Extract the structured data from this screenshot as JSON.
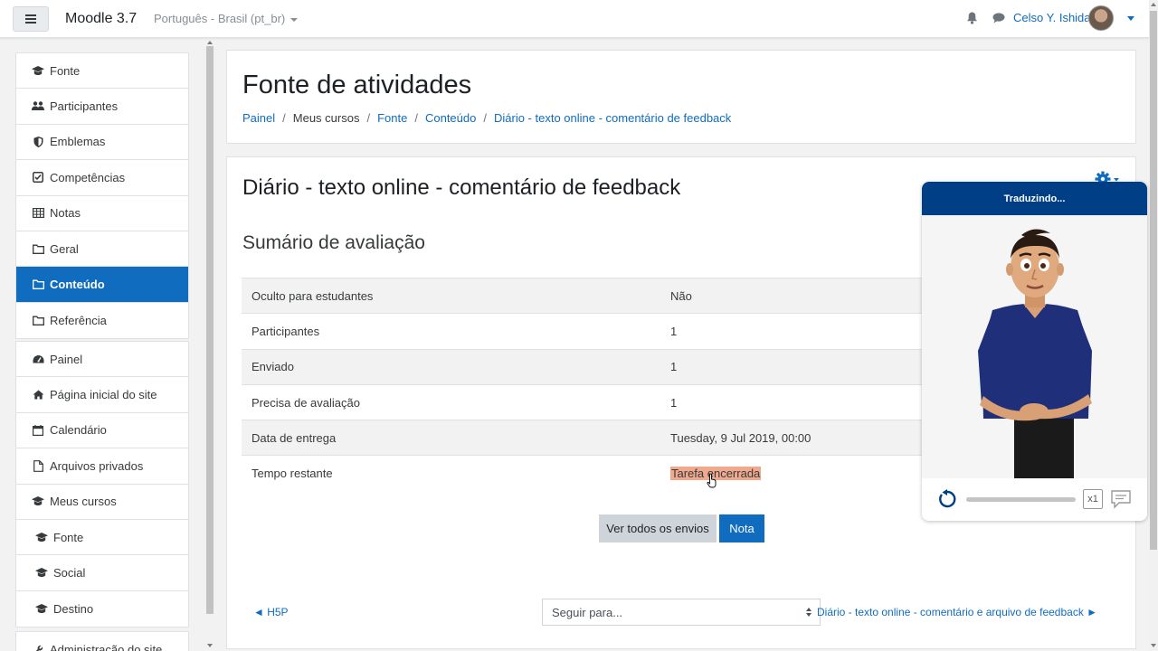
{
  "navbar": {
    "brand": "Moodle 3.7",
    "language": "Português - Brasil (pt_br)",
    "user_name": "Celso Y. Ishida"
  },
  "sidebar": {
    "course_items": [
      {
        "label": "Fonte",
        "icon": "graduation-cap-icon"
      },
      {
        "label": "Participantes",
        "icon": "users-icon"
      },
      {
        "label": "Emblemas",
        "icon": "shield-icon"
      },
      {
        "label": "Competências",
        "icon": "check-square-icon"
      },
      {
        "label": "Notas",
        "icon": "table-icon"
      },
      {
        "label": "Geral",
        "icon": "folder-icon"
      },
      {
        "label": "Conteúdo",
        "icon": "folder-icon",
        "active": true
      },
      {
        "label": "Referência",
        "icon": "folder-icon"
      }
    ],
    "site_items": [
      {
        "label": "Painel",
        "icon": "dashboard-icon"
      },
      {
        "label": "Página inicial do site",
        "icon": "home-icon"
      },
      {
        "label": "Calendário",
        "icon": "calendar-icon"
      },
      {
        "label": "Arquivos privados",
        "icon": "file-icon"
      },
      {
        "label": "Meus cursos",
        "icon": "graduation-cap-icon"
      },
      {
        "label": "Fonte",
        "icon": "graduation-cap-icon"
      },
      {
        "label": "Social",
        "icon": "graduation-cap-icon"
      },
      {
        "label": "Destino",
        "icon": "graduation-cap-icon"
      }
    ],
    "admin_item": {
      "label": "Administração do site",
      "icon": "wrench-icon"
    }
  },
  "header": {
    "title": "Fonte de atividades",
    "breadcrumb": [
      {
        "label": "Painel",
        "link": true
      },
      {
        "label": "Meus cursos",
        "link": false
      },
      {
        "label": "Fonte",
        "link": true
      },
      {
        "label": "Conteúdo",
        "link": true
      },
      {
        "label": "Diário - texto online - comentário de feedback",
        "link": true
      }
    ]
  },
  "activity": {
    "title": "Diário - texto online - comentário de feedback",
    "summary_heading": "Sumário de avaliação",
    "rows": [
      {
        "label": "Oculto para estudantes",
        "value": "Não"
      },
      {
        "label": "Participantes",
        "value": "1"
      },
      {
        "label": "Enviado",
        "value": "1"
      },
      {
        "label": "Precisa de avaliação",
        "value": "1"
      },
      {
        "label": "Data de entrega",
        "value": "Tuesday, 9 Jul 2019, 00:00"
      },
      {
        "label": "Tempo restante",
        "value": "Tarefa encerrada"
      }
    ],
    "view_all_button": "Ver todos os envios",
    "grade_button": "Nota",
    "prev_link": "◄ H5P",
    "jump_placeholder": "Seguir para...",
    "next_link": "Diário - texto online - comentário e arquivo de feedback ►"
  },
  "vlibras": {
    "status": "Traduzindo...",
    "speed": "x1"
  },
  "colors": {
    "primary": "#0f6cbf",
    "vlibras_header": "#003f86",
    "highlight": "#f0a98c"
  }
}
